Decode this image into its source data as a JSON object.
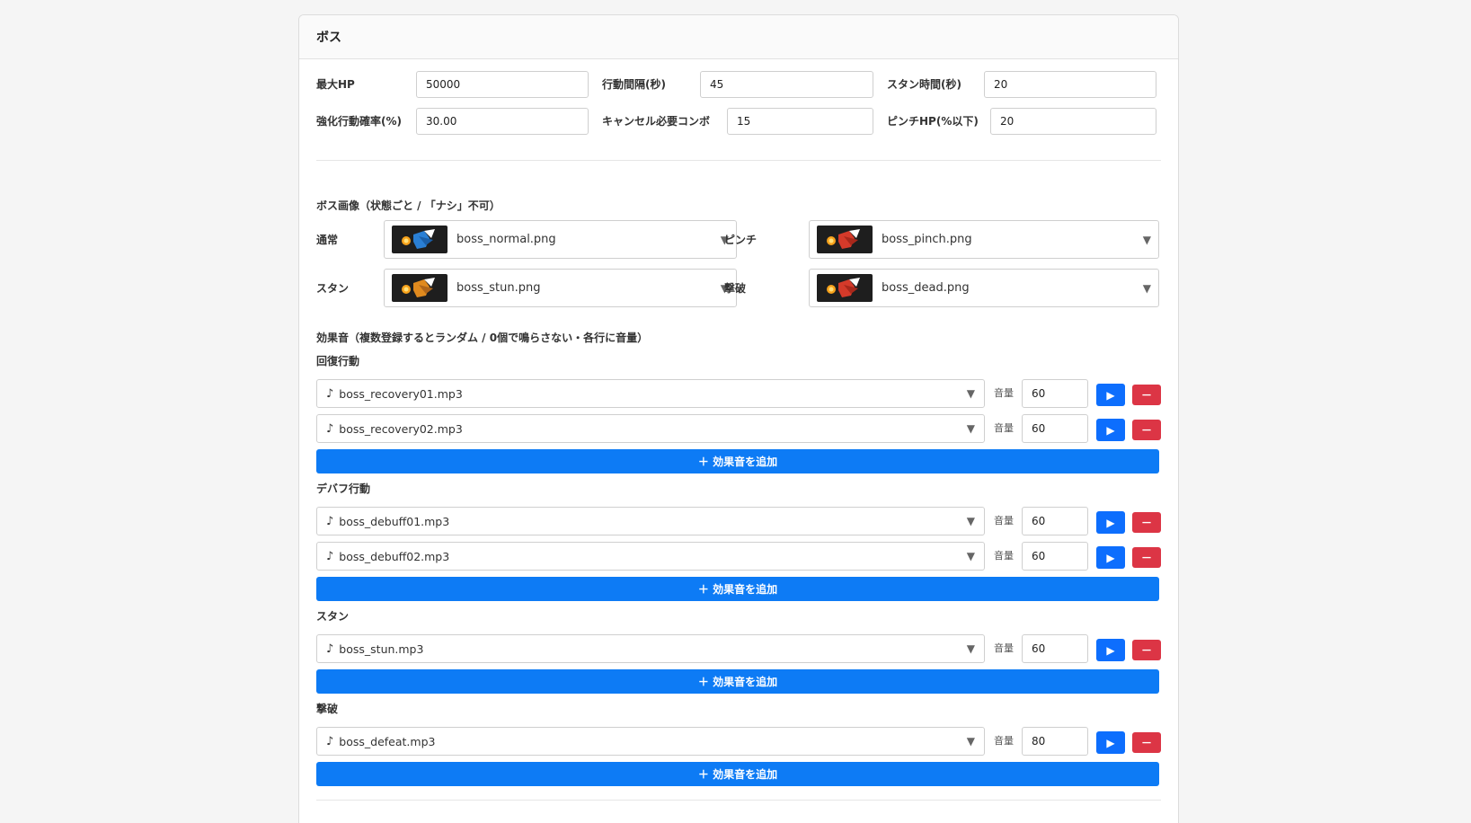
{
  "boss": {
    "title": "ボス",
    "fields": [
      {
        "label": "最大HP",
        "value": "50000"
      },
      {
        "label": "行動間隔(秒)",
        "value": "45"
      },
      {
        "label": "スタン時間(秒)",
        "value": "20"
      },
      {
        "label": "強化行動確率(%)",
        "value": "30.00"
      },
      {
        "label": "キャンセル必要コンボ",
        "value": "15"
      },
      {
        "label": "ピンチHP(%以下)",
        "value": "20"
      }
    ]
  },
  "images": {
    "title": "ボス画像（状態ごと / 「ナシ」不可）",
    "items": [
      {
        "label": "通常",
        "file": "boss_normal.png",
        "tint": "#2a7fd4"
      },
      {
        "label": "ピンチ",
        "file": "boss_pinch.png",
        "tint": "#d43a2a"
      },
      {
        "label": "スタン",
        "file": "boss_stun.png",
        "tint": "#e08a1e"
      },
      {
        "label": "撃破",
        "file": "boss_dead.png",
        "tint": "#d43a2a"
      }
    ]
  },
  "sounds": {
    "title": "効果音（複数登録するとランダム / 0個で鳴らさない・各行に音量）",
    "vol_label": "音量",
    "add_label": "＋ 効果音を追加",
    "note_icon": "♪",
    "play_icon": "▶",
    "remove_icon": "－",
    "caret": "▼",
    "groups": [
      {
        "title": "回復行動",
        "items": [
          {
            "file": "boss_recovery01.mp3",
            "volume": "60"
          },
          {
            "file": "boss_recovery02.mp3",
            "volume": "60"
          }
        ]
      },
      {
        "title": "デバフ行動",
        "items": [
          {
            "file": "boss_debuff01.mp3",
            "volume": "60"
          },
          {
            "file": "boss_debuff02.mp3",
            "volume": "60"
          }
        ]
      },
      {
        "title": "スタン",
        "items": [
          {
            "file": "boss_stun.mp3",
            "volume": "60"
          }
        ]
      },
      {
        "title": "撃破",
        "items": [
          {
            "file": "boss_defeat.mp3",
            "volume": "80"
          }
        ]
      }
    ]
  }
}
